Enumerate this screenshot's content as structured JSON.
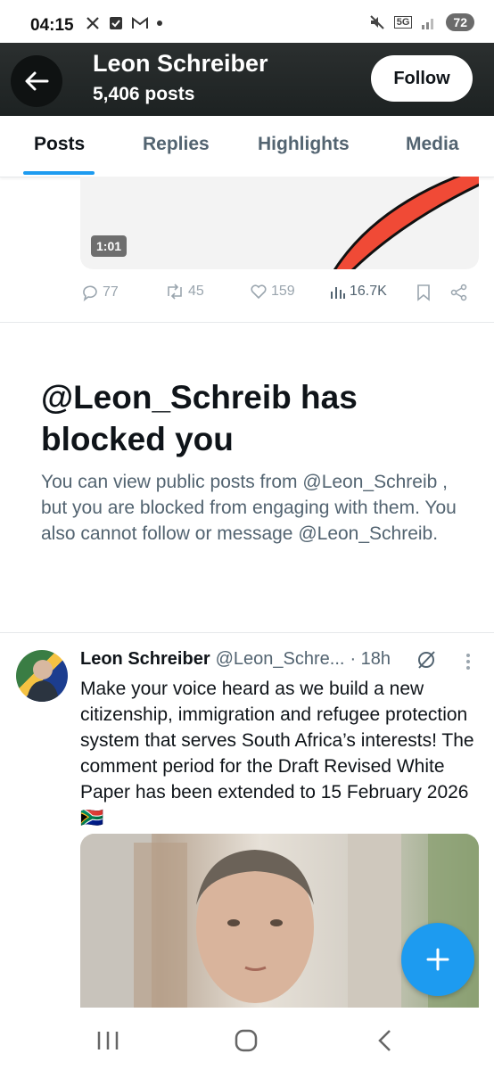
{
  "status_bar": {
    "time": "04:15",
    "battery": "72",
    "network": "5G"
  },
  "header": {
    "name": "Leon Schreiber",
    "posts": "5,406 posts",
    "follow_label": "Follow"
  },
  "tabs": [
    {
      "label": "Posts",
      "active": true
    },
    {
      "label": "Replies",
      "active": false
    },
    {
      "label": "Highlights",
      "active": false
    },
    {
      "label": "Media",
      "active": false
    }
  ],
  "previous_post": {
    "video_duration": "1:01",
    "replies": "77",
    "reposts": "45",
    "likes": "159",
    "views": "16.7K"
  },
  "blocked": {
    "title": "@Leon_Schreib has blocked you",
    "description": "You can view public posts from @Leon_Schreib , but you are blocked from engaging with them. You also cannot follow or message @Leon_Schreib."
  },
  "tweet": {
    "name": "Leon Schreiber",
    "handle": "@Leon_Schre...",
    "time": "· 18h",
    "text": "Make your voice heard as we build a new citizenship, immigration and refugee protection system that serves South Africa’s interests! The comment period for the Draft Revised White Paper has been extended to 15 February 2026 🇿🇦"
  },
  "colors": {
    "accent": "#1d9bf0",
    "text": "#0f1419",
    "muted": "#536471",
    "header_bg": "#1d2222"
  },
  "icons": [
    "back-arrow-icon",
    "reply-icon",
    "repost-icon",
    "like-icon",
    "views-icon",
    "bookmark-icon",
    "share-icon",
    "more-icon",
    "grok-icon",
    "compose-icon"
  ]
}
